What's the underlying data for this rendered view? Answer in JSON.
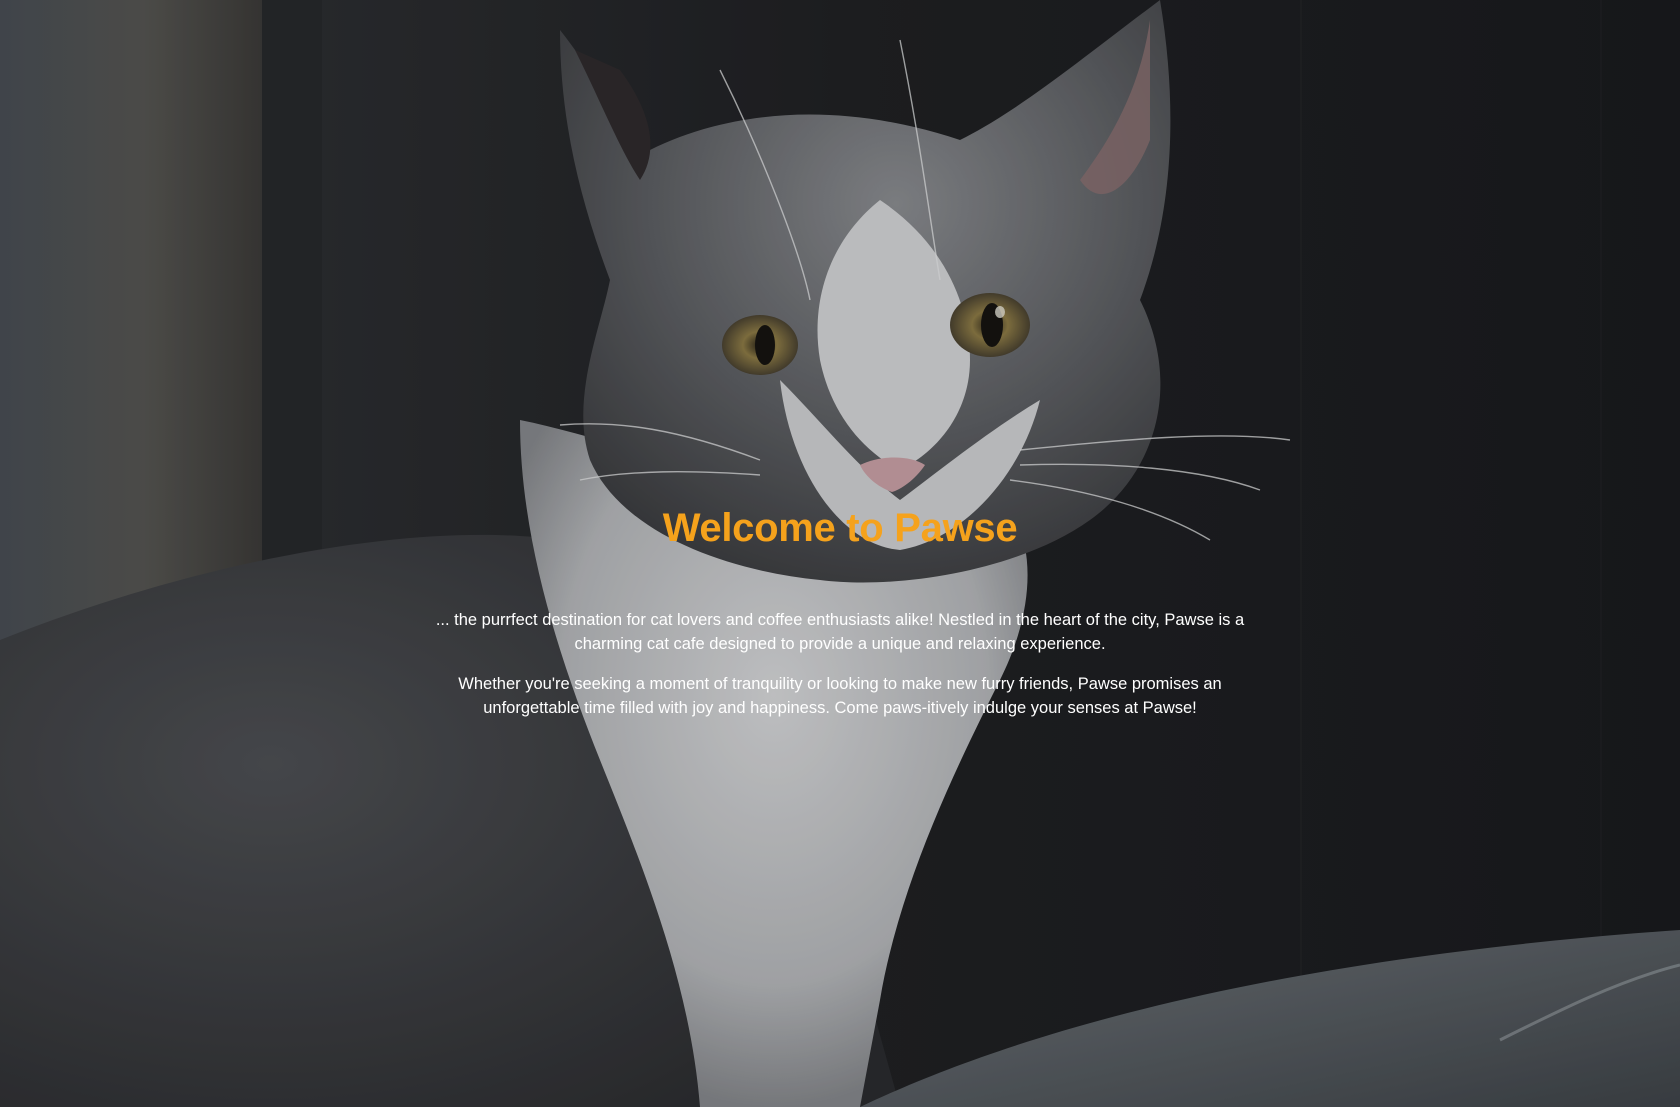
{
  "hero": {
    "title": "Welcome to Pawse",
    "paragraphs": [
      "... the purrfect destination for cat lovers and coffee enthusiasts alike! Nestled in the heart of the city, Pawse is a charming cat cafe designed to provide a unique and relaxing experience.",
      "Whether you're seeking a moment of tranquility or looking to make new furry friends, Pawse promises an unforgettable time filled with joy and happiness. Come paws-itively indulge your senses at Pawse!"
    ]
  },
  "colors": {
    "accent": "#f5a21c",
    "text": "#ffffff",
    "background": "#1b1c1f"
  }
}
